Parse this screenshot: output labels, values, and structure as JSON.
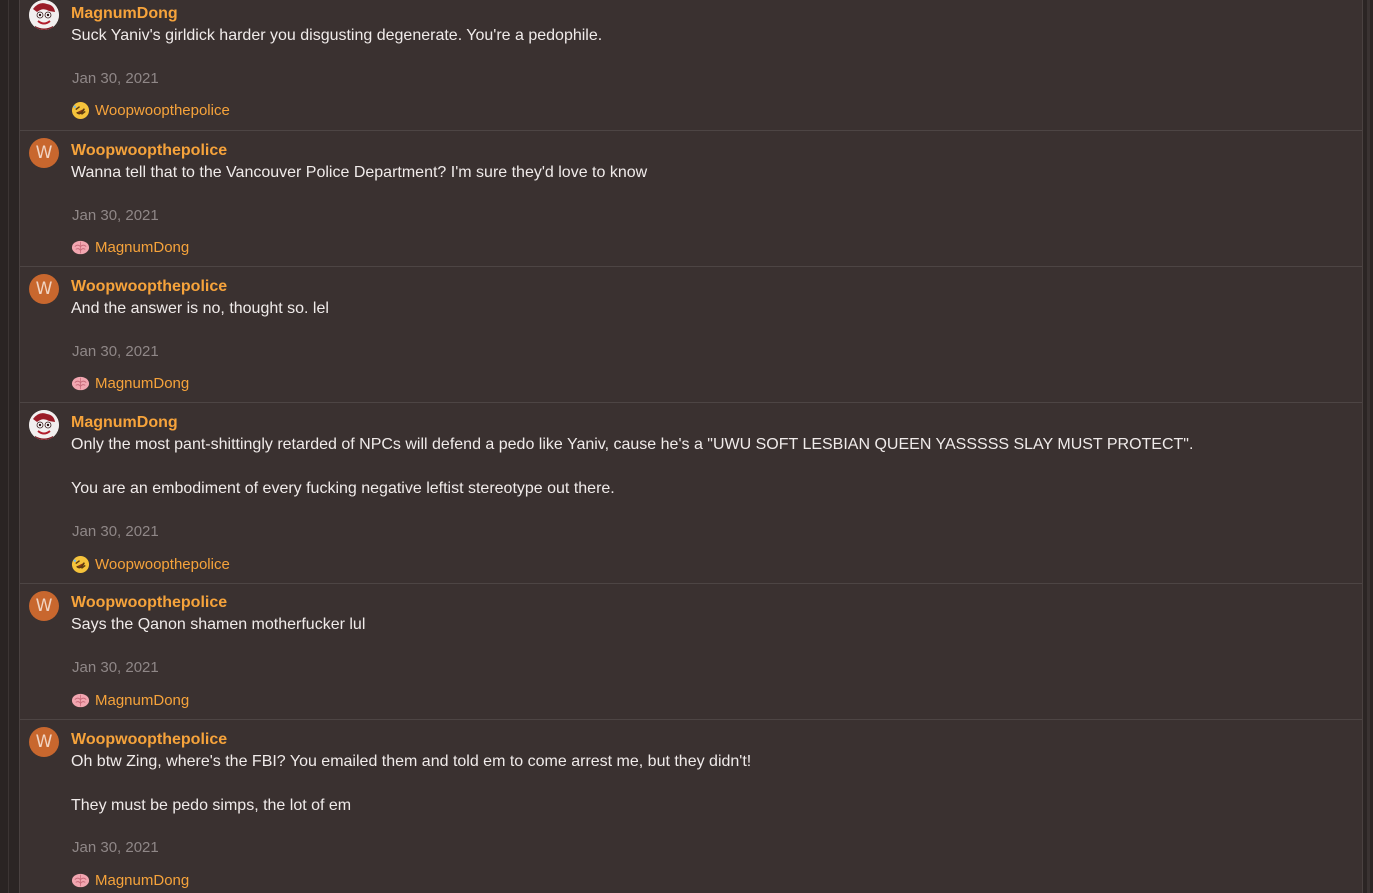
{
  "posts": [
    {
      "author": "MagnumDong",
      "avatar": "clown-avatar-icon",
      "lines": [
        "Suck Yaniv's girldick harder you disgusting degenerate. You're a pedophile."
      ],
      "date": "Jan 30, 2021",
      "reaction": {
        "emoji": "rofl-emoji-icon",
        "user": "Woopwoopthepolice"
      }
    },
    {
      "author": "Woopwoopthepolice",
      "avatar": "W",
      "lines": [
        "Wanna tell that to the Vancouver Police Department? I'm sure they'd love to know"
      ],
      "date": "Jan 30, 2021",
      "reaction": {
        "emoji": "brain-emoji-icon",
        "user": "MagnumDong"
      }
    },
    {
      "author": "Woopwoopthepolice",
      "avatar": "W",
      "lines": [
        "And the answer is no, thought so. lel"
      ],
      "date": "Jan 30, 2021",
      "reaction": {
        "emoji": "brain-emoji-icon",
        "user": "MagnumDong"
      }
    },
    {
      "author": "MagnumDong",
      "avatar": "clown-avatar-icon",
      "lines": [
        "Only the most pant-shittingly retarded of NPCs will defend a pedo like Yaniv, cause he's a \"UWU SOFT LESBIAN QUEEN YASSSSS SLAY MUST PROTECT\".",
        "You are an embodiment of every fucking negative leftist stereotype out there."
      ],
      "date": "Jan 30, 2021",
      "reaction": {
        "emoji": "rofl-emoji-icon",
        "user": "Woopwoopthepolice"
      }
    },
    {
      "author": "Woopwoopthepolice",
      "avatar": "W",
      "lines": [
        "Says the Qanon shamen motherfucker lul"
      ],
      "date": "Jan 30, 2021",
      "reaction": {
        "emoji": "brain-emoji-icon",
        "user": "MagnumDong"
      }
    },
    {
      "author": "Woopwoopthepolice",
      "avatar": "W",
      "lines": [
        "Oh btw Zing, where's the FBI? You emailed them and told em to come arrest me, but they didn't!",
        "They must be pedo simps, the lot of em"
      ],
      "date": "Jan 30, 2021",
      "reaction": {
        "emoji": "brain-emoji-icon",
        "user": "MagnumDong"
      }
    }
  ],
  "colors": {
    "author": "#f6a33b",
    "body_text": "#f0ebea",
    "date": "#8f8787",
    "avatar_w": "#c8672e",
    "panel": "#3a3130"
  }
}
